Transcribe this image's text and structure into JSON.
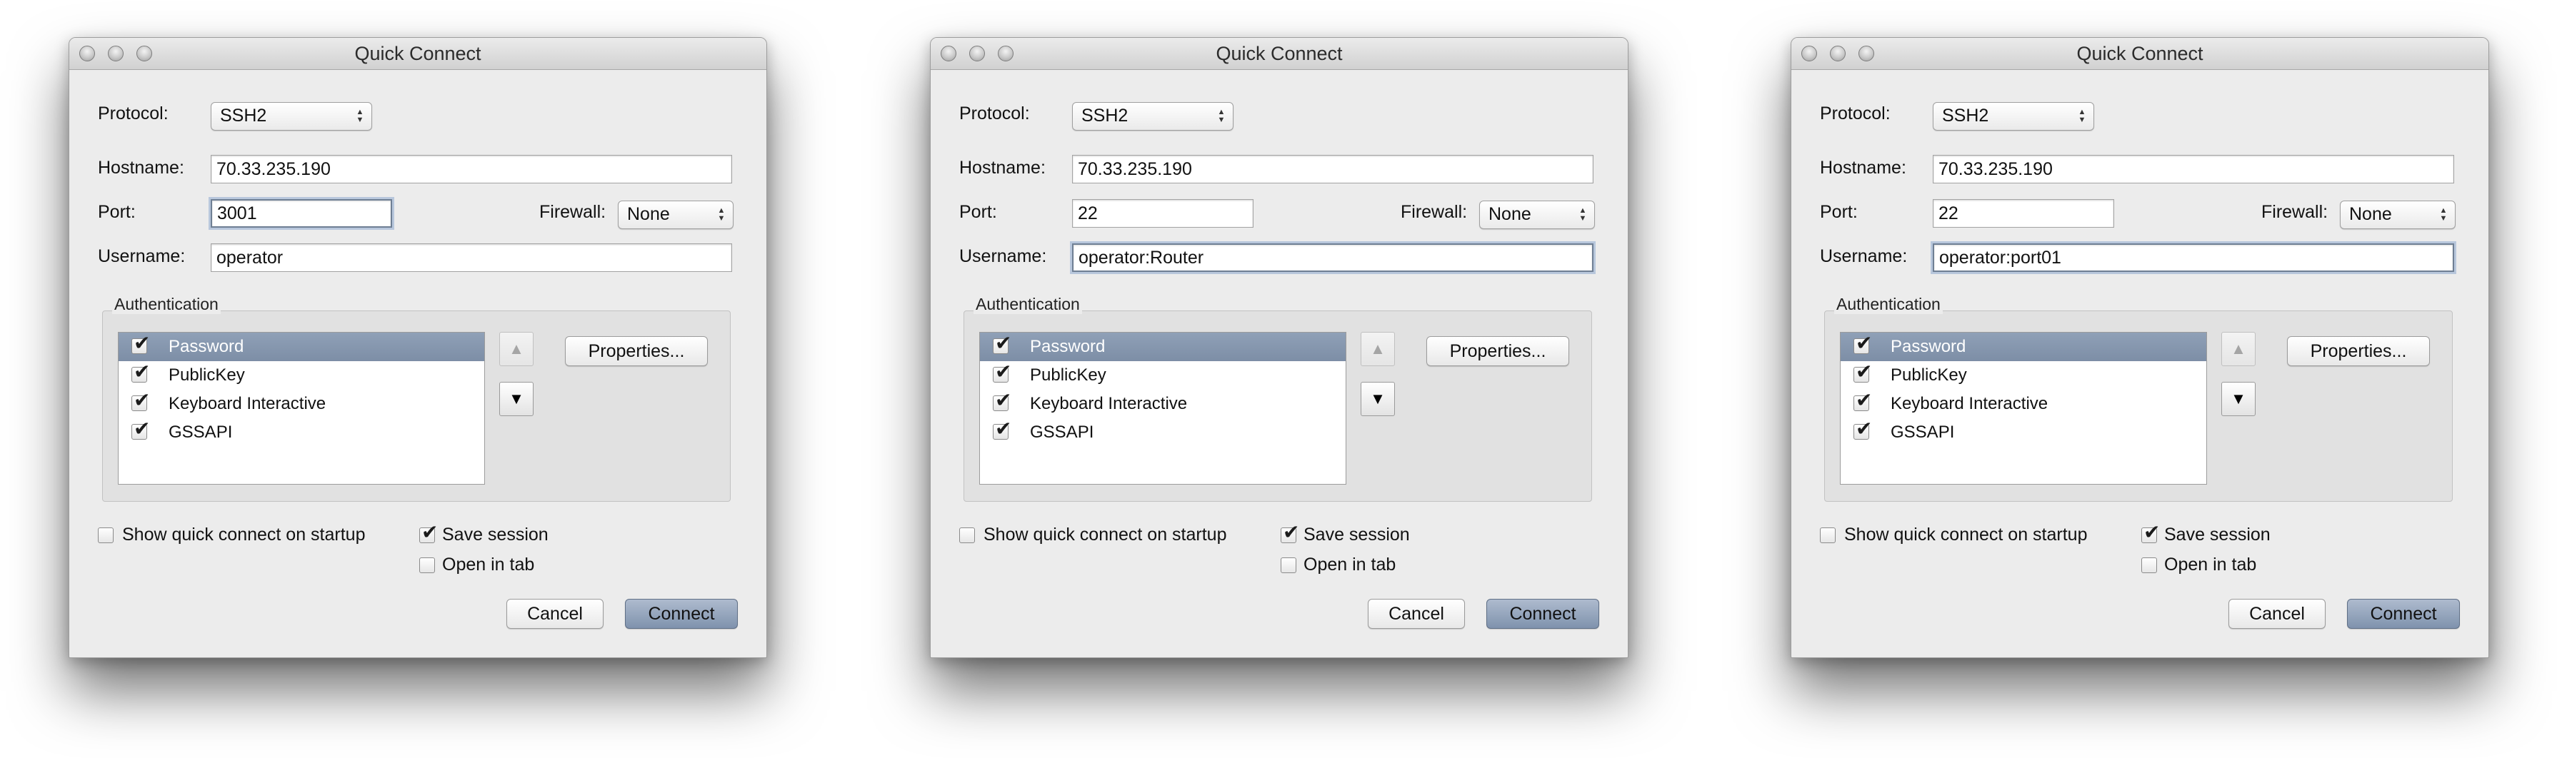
{
  "dialogs": [
    {
      "title": "Quick Connect",
      "protocol_label": "Protocol:",
      "protocol_value": "SSH2",
      "hostname_label": "Hostname:",
      "hostname_value": "70.33.235.190",
      "port_label": "Port:",
      "port_value": "3001",
      "firewall_label": "Firewall:",
      "firewall_value": "None",
      "username_label": "Username:",
      "username_value": "operator",
      "auth_title": "Authentication",
      "auth_methods": [
        "Password",
        "PublicKey",
        "Keyboard Interactive",
        "GSSAPI"
      ],
      "properties_label": "Properties...",
      "show_quick_connect_label": "Show quick connect on startup",
      "save_session_label": "Save session",
      "open_in_tab_label": "Open in tab",
      "cancel_label": "Cancel",
      "connect_label": "Connect"
    },
    {
      "title": "Quick Connect",
      "protocol_label": "Protocol:",
      "protocol_value": "SSH2",
      "hostname_label": "Hostname:",
      "hostname_value": "70.33.235.190",
      "port_label": "Port:",
      "port_value": "22",
      "firewall_label": "Firewall:",
      "firewall_value": "None",
      "username_label": "Username:",
      "username_value": "operator:Router",
      "auth_title": "Authentication",
      "auth_methods": [
        "Password",
        "PublicKey",
        "Keyboard Interactive",
        "GSSAPI"
      ],
      "properties_label": "Properties...",
      "show_quick_connect_label": "Show quick connect on startup",
      "save_session_label": "Save session",
      "open_in_tab_label": "Open in tab",
      "cancel_label": "Cancel",
      "connect_label": "Connect"
    },
    {
      "title": "Quick Connect",
      "protocol_label": "Protocol:",
      "protocol_value": "SSH2",
      "hostname_label": "Hostname:",
      "hostname_value": "70.33.235.190",
      "port_label": "Port:",
      "port_value": "22",
      "firewall_label": "Firewall:",
      "firewall_value": "None",
      "username_label": "Username:",
      "username_value": "operator:port01",
      "auth_title": "Authentication",
      "auth_methods": [
        "Password",
        "PublicKey",
        "Keyboard Interactive",
        "GSSAPI"
      ],
      "properties_label": "Properties...",
      "show_quick_connect_label": "Show quick connect on startup",
      "save_session_label": "Save session",
      "open_in_tab_label": "Open in tab",
      "cancel_label": "Cancel",
      "connect_label": "Connect"
    }
  ]
}
